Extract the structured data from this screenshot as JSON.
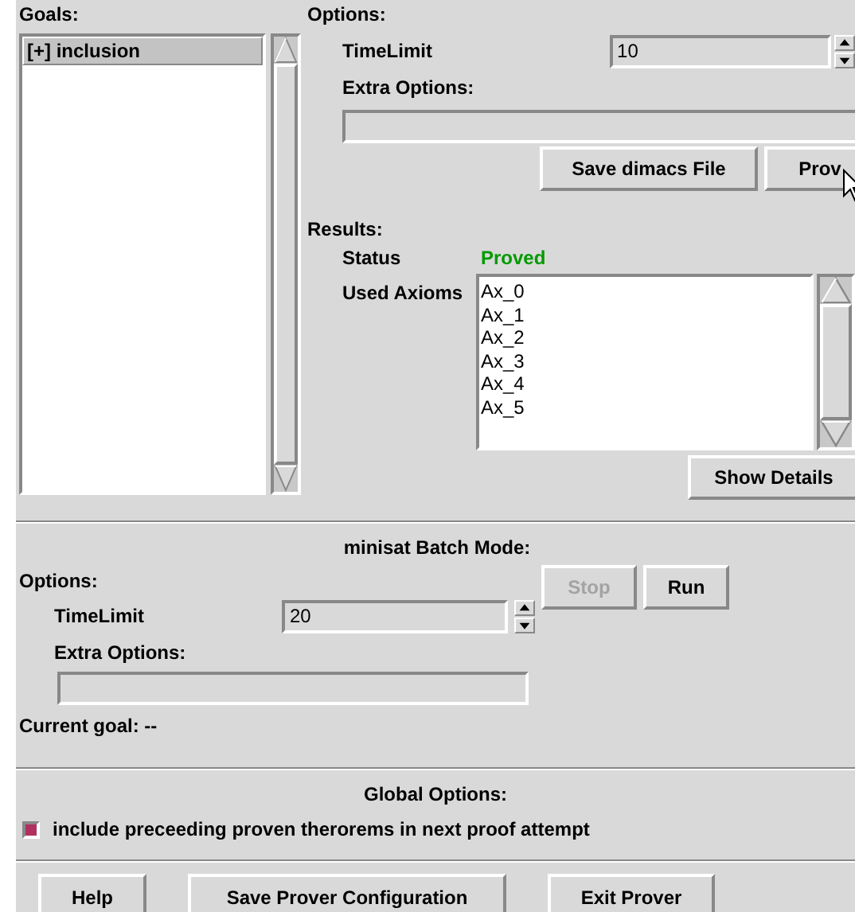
{
  "goals": {
    "label": "Goals:",
    "items": [
      {
        "text": "[+] inclusion",
        "selected": true
      }
    ]
  },
  "options": {
    "label": "Options:",
    "time_limit": {
      "label": "TimeLimit",
      "value": "10"
    },
    "extra_options": {
      "label": "Extra Options:"
    },
    "buttons": [
      {
        "label": "Save dimacs File",
        "disabled": false
      },
      {
        "label": "Prov",
        "disabled": false
      }
    ]
  },
  "results": {
    "label": "Results:",
    "status": {
      "label": "Status",
      "value": "Proved"
    },
    "used_axioms": {
      "label": "Used Axioms",
      "items": [
        "Ax_0",
        "Ax_1",
        "Ax_2",
        "Ax_3",
        "Ax_4",
        "Ax_5"
      ]
    },
    "show_details": "Show Details"
  },
  "batch": {
    "title": "minisat Batch Mode:",
    "options_label": "Options:",
    "time_limit": {
      "label": "TimeLimit",
      "value": "20"
    },
    "extra_options": {
      "label": "Extra Options:"
    },
    "buttons": [
      {
        "label": "Stop",
        "disabled": true
      },
      {
        "label": "Run",
        "disabled": false
      }
    ],
    "current_goal": "Current goal: --"
  },
  "global": {
    "title": "Global Options:",
    "checkbox": {
      "label": "include preceeding proven therorems in next proof attempt",
      "checked": true
    }
  },
  "footer_buttons": [
    "Help",
    "Save Prover Configuration",
    "Exit Prover"
  ]
}
